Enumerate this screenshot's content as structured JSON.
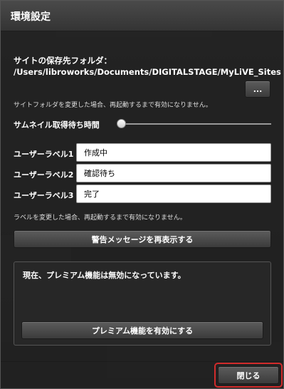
{
  "dialog": {
    "title": "環境設定",
    "site_folder_label": "サイトの保存先フォルダ：",
    "site_folder_path": "/Users/libroworks/Documents/DIGITALSTAGE/MyLiVE_Sites",
    "browse_button": "...",
    "site_folder_note": "サイトフォルダを変更した場合、再起動するまで有効になりません。",
    "thumbnail_wait_label": "サムネイル取得待ち時間",
    "thumbnail_wait_value": 0.0,
    "user_labels": [
      {
        "label": "ユーザーラベル1",
        "value": "作成中"
      },
      {
        "label": "ユーザーラベル2",
        "value": "確認待ち"
      },
      {
        "label": "ユーザーラベル3",
        "value": "完了"
      }
    ],
    "labels_note": "ラベルを変更した場合、再起動するまで有効になりません。",
    "reshow_warnings_button": "警告メッセージを再表示する",
    "premium_status": "現在、プレミアム機能は無効になっています。",
    "enable_premium_button": "プレミアム機能を有効にする",
    "close_button": "閉じる"
  },
  "highlight_color": "#d12b2b"
}
